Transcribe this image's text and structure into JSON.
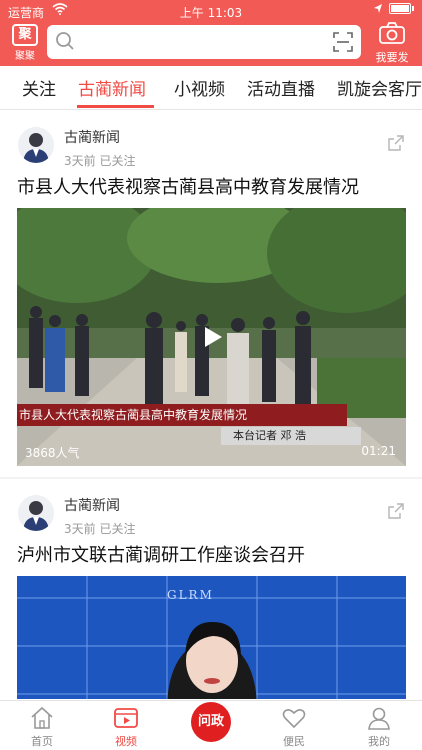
{
  "status_bar": {
    "carrier": "运营商",
    "time": "上午 11:03"
  },
  "header": {
    "logo_label": "聚聚",
    "logo_mark": "聚",
    "post_label": "我要发"
  },
  "tabs": [
    {
      "label": "关注"
    },
    {
      "label": "古蔺新闻",
      "active": true
    },
    {
      "label": "小视频"
    },
    {
      "label": "活动直播"
    },
    {
      "label": "凯旋会客厅"
    }
  ],
  "feed": [
    {
      "source": "古蔺新闻",
      "meta": "3天前  已关注",
      "title": "市县人大代表视察古蔺县高中教育发展情况",
      "video_caption": "市县人大代表视察古蔺县高中教育发展情况",
      "video_reporter": "本台记者    邓  浩",
      "views": "3868人气",
      "duration": "01:21"
    },
    {
      "source": "古蔺新闻",
      "meta": "3天前  已关注",
      "title": "泸州市文联古蔺调研工作座谈会召开",
      "video_watermark": "GLRM"
    }
  ],
  "bottom_nav": [
    {
      "label": "首页",
      "icon": "home-icon"
    },
    {
      "label": "视频",
      "icon": "video-icon",
      "active": true
    },
    {
      "label": "问政",
      "icon": "wenzheng-icon"
    },
    {
      "label": "便民",
      "icon": "heart-icon"
    },
    {
      "label": "我的",
      "icon": "user-icon"
    }
  ],
  "colors": {
    "brand": "#f25a55",
    "accent": "#f04b45"
  }
}
